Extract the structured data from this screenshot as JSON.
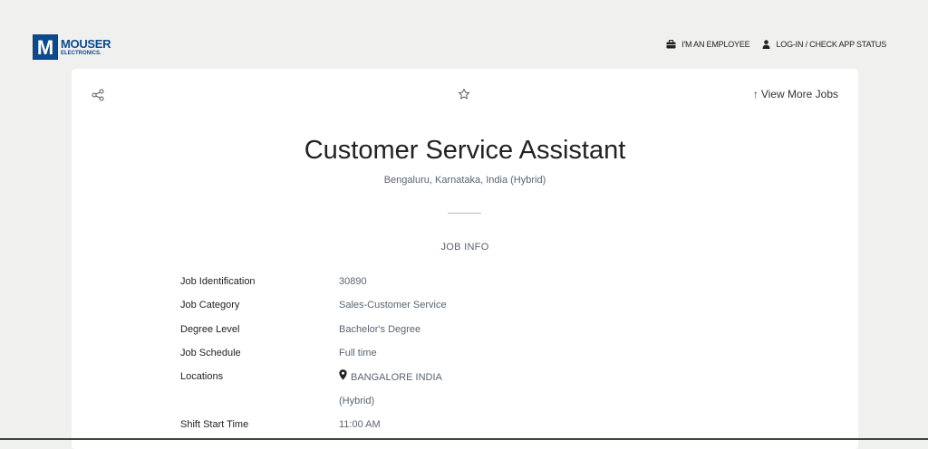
{
  "brand": {
    "mark": "M",
    "line1": "MOUSER",
    "line2": "ELECTRONICS."
  },
  "header": {
    "employee_link": "I'M AN EMPLOYEE",
    "login_link": "LOG-IN / CHECK APP STATUS"
  },
  "toolbar": {
    "view_more": "View More Jobs",
    "view_more_arrow": "↑"
  },
  "job": {
    "title": "Customer Service Assistant",
    "location": "Bengaluru, Karnataka, India (Hybrid)"
  },
  "job_info": {
    "heading": "JOB INFO",
    "rows": [
      {
        "label": "Job Identification",
        "value": "30890"
      },
      {
        "label": "Job Category",
        "value": "Sales-Customer Service"
      },
      {
        "label": "Degree Level",
        "value": "Bachelor's Degree"
      },
      {
        "label": "Job Schedule",
        "value": "Full time"
      },
      {
        "label": "Locations",
        "value": "BANGALORE INDIA"
      },
      {
        "label": "",
        "value": "(Hybrid)"
      },
      {
        "label": "Shift Start Time",
        "value": "11:00 AM"
      }
    ]
  },
  "colors": {
    "brand_blue": "#0c4a8f",
    "muted_text": "#5a6472",
    "page_bg": "#f0f0ee"
  },
  "icons": [
    "briefcase-icon",
    "user-icon",
    "share-icon",
    "star-icon",
    "map-pin-icon"
  ]
}
